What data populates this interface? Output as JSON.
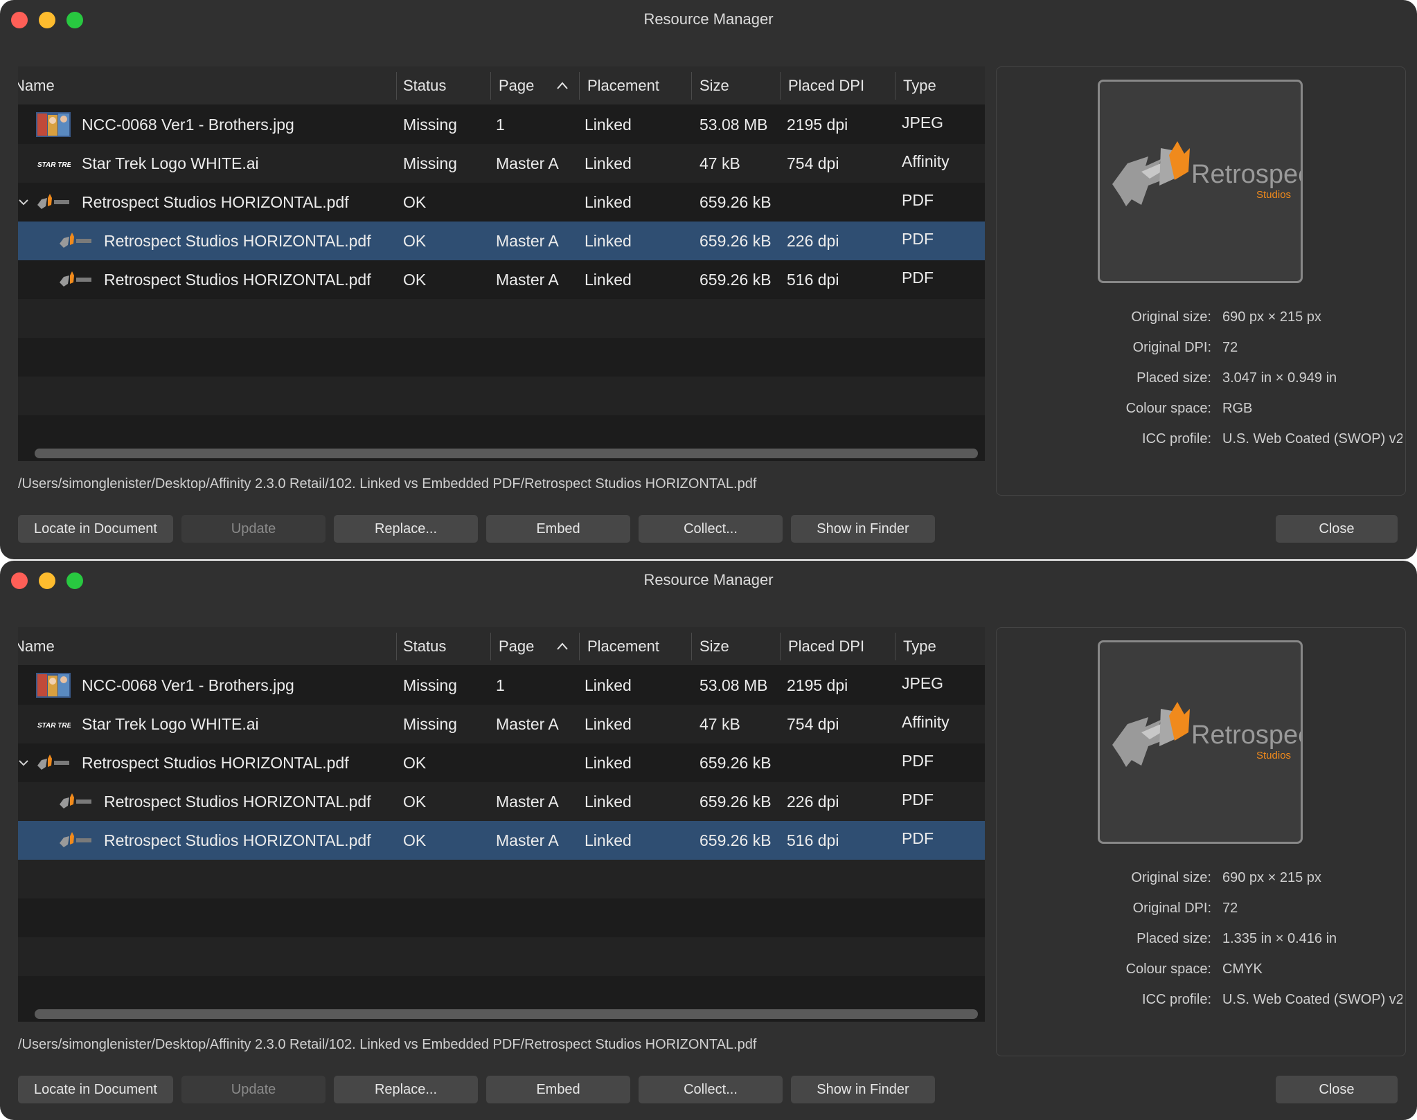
{
  "windows": [
    {
      "title": "Resource Manager",
      "columns": [
        "Name",
        "Status",
        "Page",
        "Placement",
        "Size",
        "Placed DPI",
        "Type"
      ],
      "rows": [
        {
          "name": "NCC-0068 Ver1 - Brothers.jpg",
          "status": "Missing",
          "page": "1",
          "placement": "Linked",
          "size": "53.08 MB",
          "dpi": "2195 dpi",
          "type": "JPEG",
          "icon": "photo-thumbnail",
          "indent": 0,
          "selected": false
        },
        {
          "name": "Star Trek Logo WHITE.ai",
          "status": "Missing",
          "page": "Master A",
          "placement": "Linked",
          "size": "47 kB",
          "dpi": "754 dpi",
          "type": "Affinity",
          "icon": "star-trek-logo-thumbnail",
          "indent": 0,
          "selected": false
        },
        {
          "name": "Retrospect Studios HORIZONTAL.pdf",
          "status": "OK",
          "page": "",
          "placement": "Linked",
          "size": "659.26 kB",
          "dpi": "",
          "type": "PDF",
          "icon": "retrospect-logo-thumbnail",
          "indent": 0,
          "expanded": true,
          "selected": false
        },
        {
          "name": "Retrospect Studios HORIZONTAL.pdf",
          "status": "OK",
          "page": "Master A",
          "placement": "Linked",
          "size": "659.26 kB",
          "dpi": "226 dpi",
          "type": "PDF",
          "icon": "retrospect-logo-thumbnail",
          "indent": 1,
          "selected": true
        },
        {
          "name": "Retrospect Studios HORIZONTAL.pdf",
          "status": "OK",
          "page": "Master A",
          "placement": "Linked",
          "size": "659.26 kB",
          "dpi": "516 dpi",
          "type": "PDF",
          "icon": "retrospect-logo-thumbnail",
          "indent": 1,
          "selected": false
        }
      ],
      "path": "/Users/simonglenister/Desktop/Affinity 2.3.0 Retail/102. Linked vs Embedded PDF/Retrospect Studios HORIZONTAL.pdf",
      "preview": {
        "logo_text": "Retrospect",
        "logo_subtext": "Studios"
      },
      "info": [
        {
          "label": "Original size:",
          "value": "690 px × 215 px"
        },
        {
          "label": "Original DPI:",
          "value": "72"
        },
        {
          "label": "Placed size:",
          "value": "3.047 in × 0.949 in"
        },
        {
          "label": "Colour space:",
          "value": "RGB"
        },
        {
          "label": "ICC profile:",
          "value": "U.S. Web Coated (SWOP) v2"
        }
      ],
      "buttons": {
        "locate": "Locate in Document",
        "update": "Update",
        "replace": "Replace...",
        "embed": "Embed",
        "collect": "Collect...",
        "show_in_finder": "Show in Finder",
        "close": "Close"
      }
    },
    {
      "title": "Resource Manager",
      "columns": [
        "Name",
        "Status",
        "Page",
        "Placement",
        "Size",
        "Placed DPI",
        "Type"
      ],
      "rows": [
        {
          "name": "NCC-0068 Ver1 - Brothers.jpg",
          "status": "Missing",
          "page": "1",
          "placement": "Linked",
          "size": "53.08 MB",
          "dpi": "2195 dpi",
          "type": "JPEG",
          "icon": "photo-thumbnail",
          "indent": 0,
          "selected": false
        },
        {
          "name": "Star Trek Logo WHITE.ai",
          "status": "Missing",
          "page": "Master A",
          "placement": "Linked",
          "size": "47 kB",
          "dpi": "754 dpi",
          "type": "Affinity",
          "icon": "star-trek-logo-thumbnail",
          "indent": 0,
          "selected": false
        },
        {
          "name": "Retrospect Studios HORIZONTAL.pdf",
          "status": "OK",
          "page": "",
          "placement": "Linked",
          "size": "659.26 kB",
          "dpi": "",
          "type": "PDF",
          "icon": "retrospect-logo-thumbnail",
          "indent": 0,
          "expanded": true,
          "selected": false
        },
        {
          "name": "Retrospect Studios HORIZONTAL.pdf",
          "status": "OK",
          "page": "Master A",
          "placement": "Linked",
          "size": "659.26 kB",
          "dpi": "226 dpi",
          "type": "PDF",
          "icon": "retrospect-logo-thumbnail",
          "indent": 1,
          "selected": false
        },
        {
          "name": "Retrospect Studios HORIZONTAL.pdf",
          "status": "OK",
          "page": "Master A",
          "placement": "Linked",
          "size": "659.26 kB",
          "dpi": "516 dpi",
          "type": "PDF",
          "icon": "retrospect-logo-thumbnail",
          "indent": 1,
          "selected": true
        }
      ],
      "path": "/Users/simonglenister/Desktop/Affinity 2.3.0 Retail/102. Linked vs Embedded PDF/Retrospect Studios HORIZONTAL.pdf",
      "preview": {
        "logo_text": "Retrospect",
        "logo_subtext": "Studios"
      },
      "info": [
        {
          "label": "Original size:",
          "value": "690 px × 215 px"
        },
        {
          "label": "Original DPI:",
          "value": "72"
        },
        {
          "label": "Placed size:",
          "value": "1.335 in × 0.416 in"
        },
        {
          "label": "Colour space:",
          "value": "CMYK"
        },
        {
          "label": "ICC profile:",
          "value": "U.S. Web Coated (SWOP) v2"
        }
      ],
      "buttons": {
        "locate": "Locate in Document",
        "update": "Update",
        "replace": "Replace...",
        "embed": "Embed",
        "collect": "Collect...",
        "show_in_finder": "Show in Finder",
        "close": "Close"
      }
    }
  ],
  "colors": {
    "window_bg": "#303030",
    "table_bg": "#1c1c1c",
    "selection": "#2f4e72",
    "logo_orange": "#f08a1c"
  }
}
